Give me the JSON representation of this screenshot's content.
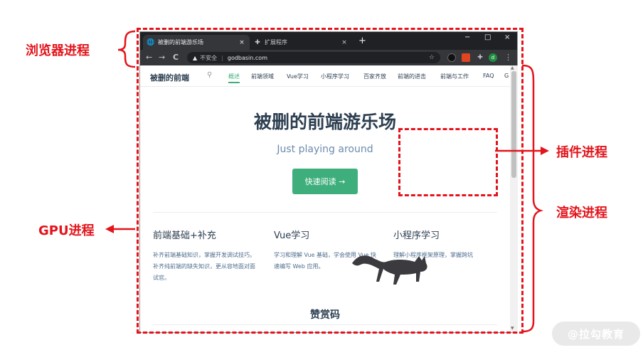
{
  "browser": {
    "tabs": [
      {
        "title": "被删的前端游乐场",
        "icon": "globe-icon",
        "close": "×",
        "active": true
      },
      {
        "title": "扩展程序",
        "icon": "puzzle-icon",
        "close": "×",
        "active": false
      }
    ],
    "new_tab": "+",
    "window_controls": {
      "minimize": "−",
      "maximize": "□",
      "close": "×"
    },
    "toolbar": {
      "back": "←",
      "forward": "→",
      "reload": "C",
      "security_label": "不安全",
      "url": "godbasin.com",
      "bookmark": "☆",
      "avatar_letter": "d",
      "menu": "⋮"
    }
  },
  "site": {
    "title": "被删的前端",
    "nav": [
      "概述",
      "前端领域",
      "Vue学习",
      "小程序学习",
      "百家齐放",
      "前端的进击",
      "前端与工作",
      "FAQ",
      "G"
    ],
    "hero_title": "被删的前端游乐场",
    "hero_subtitle": "Just playing around",
    "hero_button": "快速阅读 →",
    "features": [
      {
        "title": "前端基础+补充",
        "desc": "补齐前端基础知识，掌握开发调试技巧。补齐纯前端的缺失知识，更从容地面对面试官。"
      },
      {
        "title": "Vue学习",
        "desc": "学习和理解 Vue 基础，学会使用 Vue 快速编写 Web 应用。"
      },
      {
        "title": "小程序学习",
        "desc": "理解小程序框架原理，掌握跨坑"
      }
    ],
    "donate_title": "赞赏码"
  },
  "annotations": {
    "browser_process": "浏览器进程",
    "gpu_process": "GPU进程",
    "plugin_process": "插件进程",
    "render_process": "渲染进程",
    "color": "#e3141b"
  },
  "watermark": "@拉勾教育",
  "colors": {
    "accent": "#3eaf7c",
    "annotation": "#e3141b",
    "tab_bar": "#202124"
  }
}
